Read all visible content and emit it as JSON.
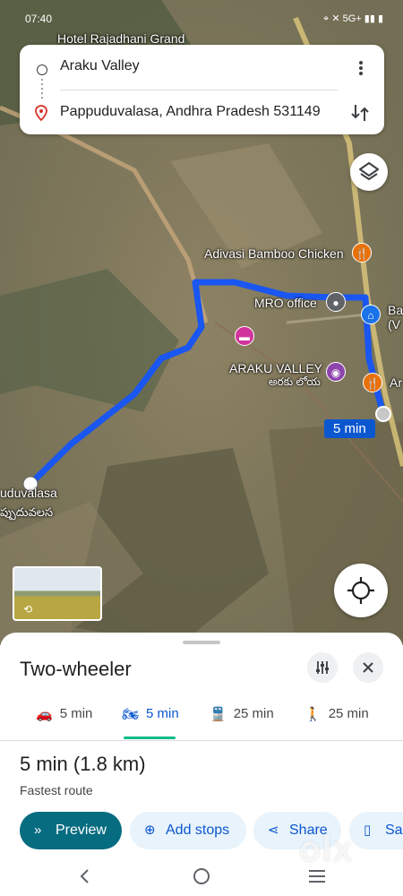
{
  "status_bar": {
    "time": "07:40",
    "icons_text": "5G+"
  },
  "directions": {
    "origin": "Araku Valley",
    "destination": "Pappuduvalasa, Andhra Pradesh 531149"
  },
  "map": {
    "labels": {
      "hotel": "Hotel Rajadhani Grand",
      "adivasi": "Adivasi Bamboo Chicken",
      "mro": "MRO office",
      "araku": "ARAKU VALLEY",
      "araku_telugu": "అరకు లోయ",
      "pappuduvalasa": "uduvalasa",
      "pappuduvalasa_telugu": "ప్పుదువలస",
      "ba": "Ba",
      "v": "(V",
      "ar": "Ar"
    },
    "route_time": "5 min",
    "colors": {
      "route": "#1a56f0",
      "route_chip": "#0b57d0"
    }
  },
  "sheet": {
    "mode_title": "Two-wheeler",
    "tabs": [
      {
        "icon": "car-icon",
        "label": "5 min"
      },
      {
        "icon": "motorbike-icon",
        "label": "5 min"
      },
      {
        "icon": "transit-icon",
        "label": "25 min"
      },
      {
        "icon": "walk-icon",
        "label": "25 min"
      }
    ],
    "summary": "5 min (1.8 km)",
    "subtitle": "Fastest route",
    "actions": [
      {
        "icon": "chevrons-right-icon",
        "label": "Preview"
      },
      {
        "icon": "add-pin-icon",
        "label": "Add stops"
      },
      {
        "icon": "share-icon",
        "label": "Share"
      },
      {
        "icon": "bookmark-icon",
        "label": "Sa"
      }
    ]
  },
  "watermark": "olx"
}
